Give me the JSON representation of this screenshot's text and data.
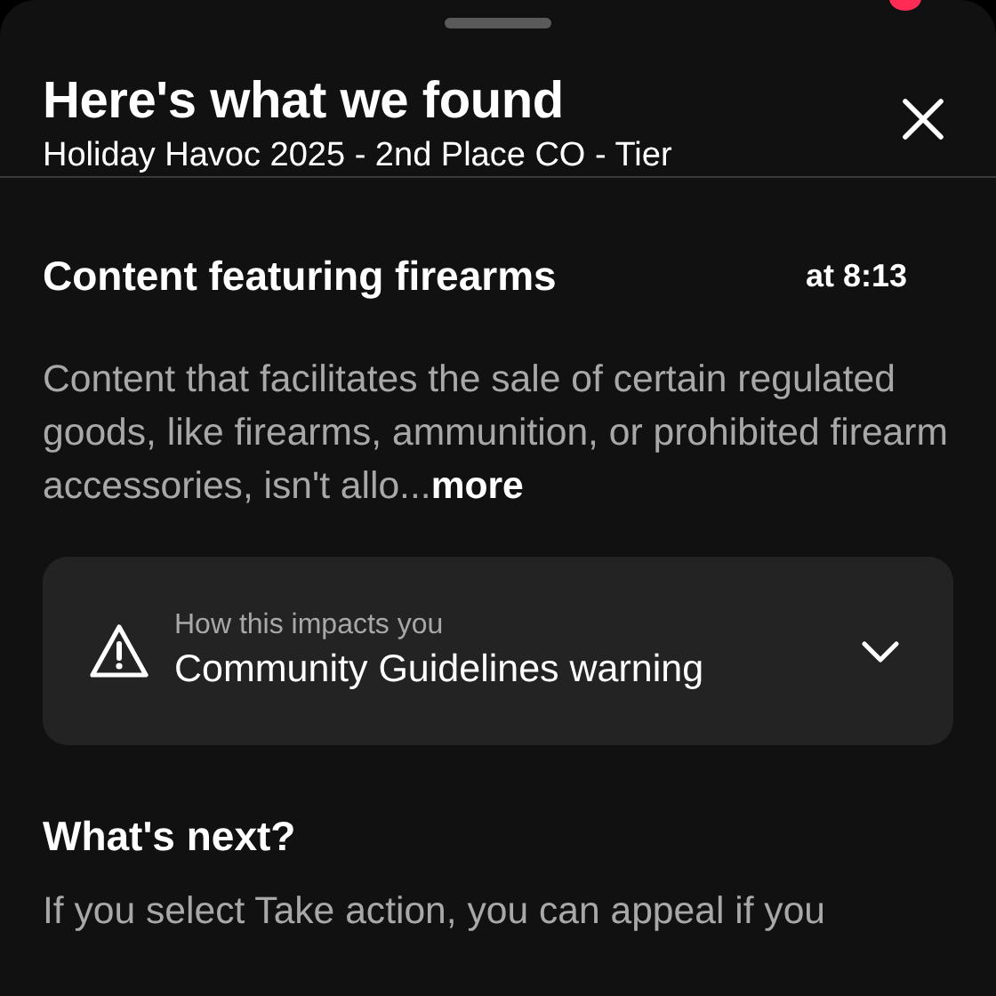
{
  "sheet": {
    "title": "Here's what we found",
    "subtitle": "Holiday Havoc 2025 - 2nd Place CO - Tier"
  },
  "violation": {
    "heading": "Content featuring firearms",
    "timestamp": "at 8:13",
    "description": "Content that facilitates the sale of certain regulated goods, like firearms, ammunition, or prohibited firearm accessories, isn't allo...",
    "more_link": "more"
  },
  "impact": {
    "label": "How this impacts you",
    "value": "Community Guidelines warning",
    "expanded": false
  },
  "next": {
    "heading": "What's next?",
    "text": "If you select Take action, you can appeal if you"
  }
}
